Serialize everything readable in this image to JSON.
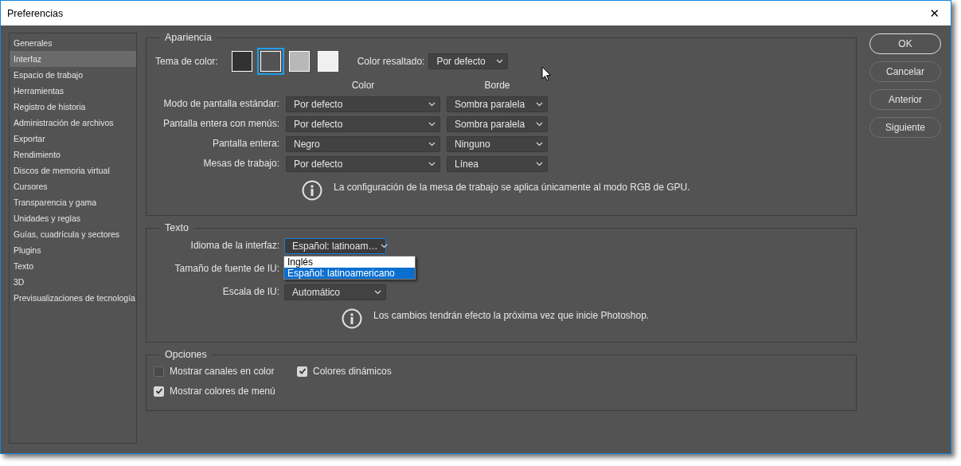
{
  "window": {
    "title": "Preferencias",
    "close": "✕"
  },
  "sidebar": {
    "items": [
      {
        "label": "Generales",
        "selected": false
      },
      {
        "label": "Interfaz",
        "selected": true
      },
      {
        "label": "Espacio de trabajo",
        "selected": false
      },
      {
        "label": "Herramientas",
        "selected": false
      },
      {
        "label": "Registro de historia",
        "selected": false
      },
      {
        "label": "Administración de archivos",
        "selected": false
      },
      {
        "label": "Exportar",
        "selected": false
      },
      {
        "label": "Rendimiento",
        "selected": false
      },
      {
        "label": "Discos de memoria virtual",
        "selected": false
      },
      {
        "label": "Cursores",
        "selected": false
      },
      {
        "label": "Transparencia y gama",
        "selected": false
      },
      {
        "label": "Unidades y reglas",
        "selected": false
      },
      {
        "label": "Guías, cuadrícula y sectores",
        "selected": false
      },
      {
        "label": "Plugins",
        "selected": false
      },
      {
        "label": "Texto",
        "selected": false
      },
      {
        "label": "3D",
        "selected": false
      },
      {
        "label": "Previsualizaciones de tecnología",
        "selected": false
      }
    ]
  },
  "appearance": {
    "title": "Apariencia",
    "theme_label": "Tema de color:",
    "themes": [
      {
        "color": "#323232",
        "selected": false
      },
      {
        "color": "#535353",
        "selected": true
      },
      {
        "color": "#b8b8b8",
        "selected": false
      },
      {
        "color": "#f0f0f0",
        "selected": false
      }
    ],
    "highlight_label": "Color resaltado:",
    "highlight_value": "Por defecto",
    "column_1": "Color",
    "column_2": "Borde",
    "rows": [
      {
        "label": "Modo de pantalla estándar:",
        "color_value": "Por defecto",
        "border": "Sombra paralela"
      },
      {
        "label": "Pantalla entera con menús:",
        "color_value": "Por defecto",
        "border": "Sombra paralela"
      },
      {
        "label": "Pantalla entera:",
        "color_value": "Negro",
        "border": "Ninguno"
      },
      {
        "label": "Mesas de trabajo:",
        "color_value": "Por defecto",
        "border": "Línea"
      }
    ],
    "note": "La configuración de la mesa de trabajo se aplica únicamente al modo RGB de GPU."
  },
  "text": {
    "title": "Texto",
    "language_label": "Idioma de la interfaz:",
    "language_value": "Español: latinoam…",
    "language_options": [
      {
        "label": "Inglés",
        "selected": false
      },
      {
        "label": "Español: latinoamericano",
        "selected": true
      }
    ],
    "font_size_label": "Tamaño de fuente de IU:",
    "scale_label": "Escala de IU:",
    "scale_value": "Automático",
    "note": "Los cambios tendrán efecto la próxima vez que inicie Photoshop."
  },
  "options": {
    "title": "Opciones",
    "checkboxes": [
      {
        "label": "Mostrar canales en color",
        "checked": false
      },
      {
        "label": "Colores dinámicos",
        "checked": true
      },
      {
        "label": "Mostrar colores de menú",
        "checked": true
      }
    ]
  },
  "buttons": [
    {
      "label": "OK",
      "default": true
    },
    {
      "label": "Cancelar",
      "default": false
    },
    {
      "label": "Anterior",
      "default": false
    },
    {
      "label": "Siguiente",
      "default": false
    }
  ]
}
